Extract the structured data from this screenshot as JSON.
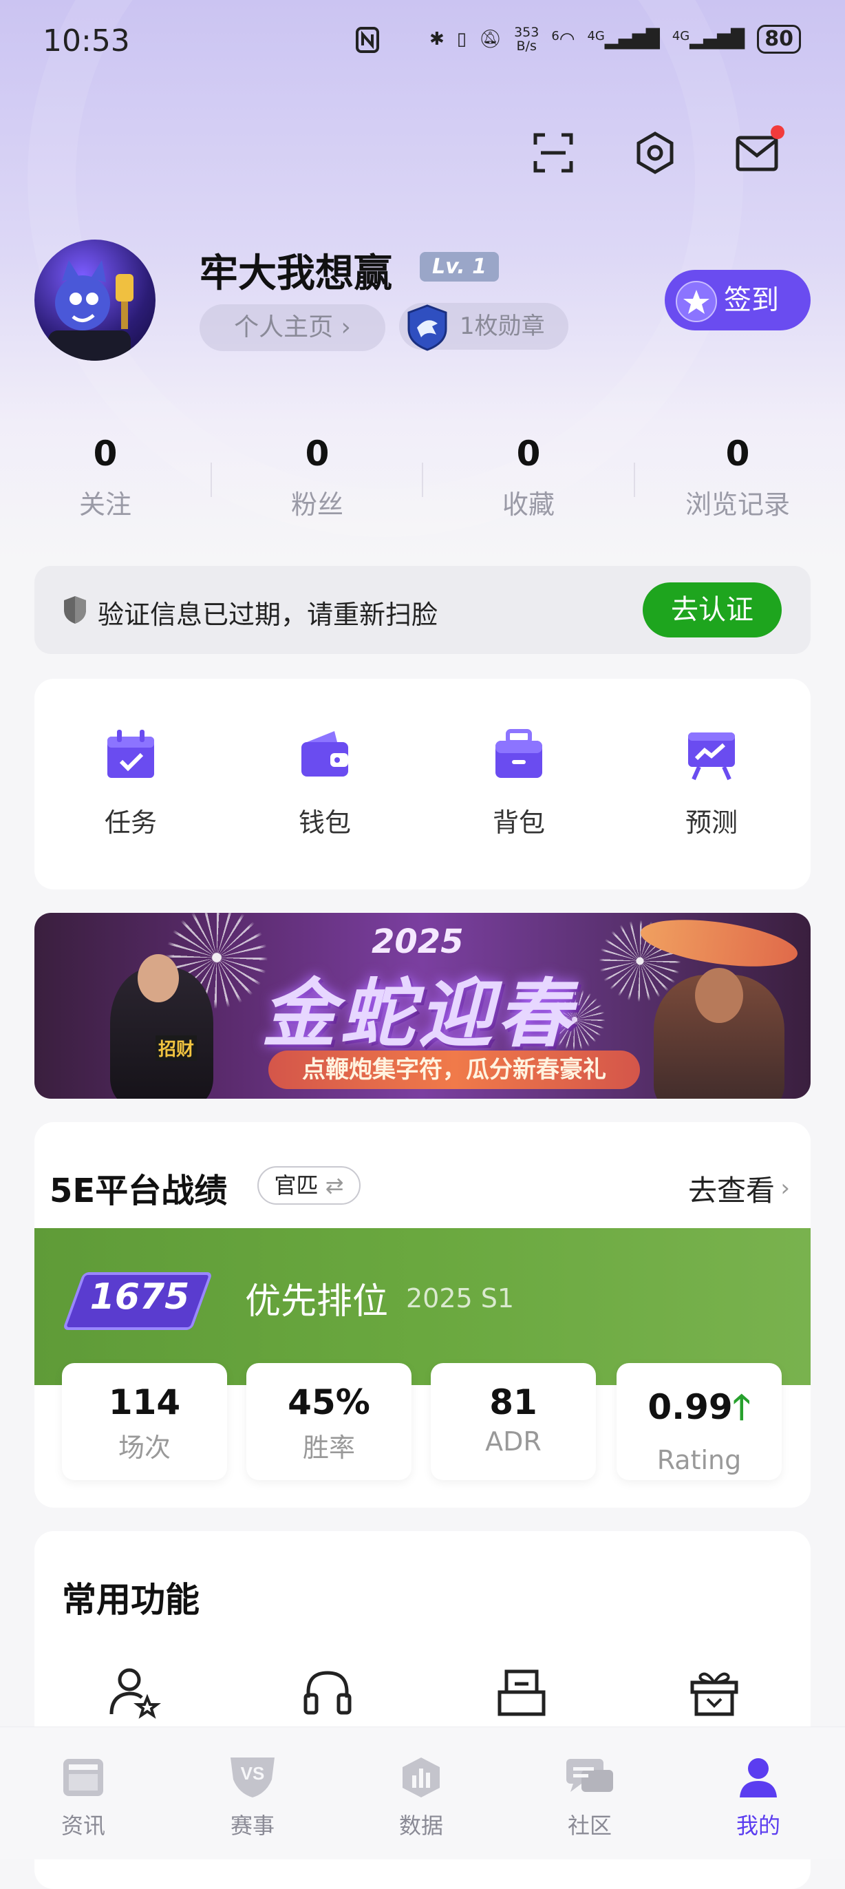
{
  "status_bar": {
    "time": "10:53",
    "net_speed_top": "353",
    "net_speed_bottom": "B/s",
    "sim1": "4G",
    "sim2": "4G",
    "wifi_label": "6",
    "battery": "80"
  },
  "profile": {
    "username": "牢大我想赢",
    "level": "Lv. 1",
    "homepage_label": "个人主页",
    "medal_label": "1枚勋章",
    "signin_label": "签到"
  },
  "stats": [
    {
      "value": "0",
      "label": "关注"
    },
    {
      "value": "0",
      "label": "粉丝"
    },
    {
      "value": "0",
      "label": "收藏"
    },
    {
      "value": "0",
      "label": "浏览记录"
    }
  ],
  "verify": {
    "message": "验证信息已过期，请重新扫脸",
    "button": "去认证"
  },
  "functions": [
    {
      "label": "任务",
      "icon": "calendar-check-icon"
    },
    {
      "label": "钱包",
      "icon": "wallet-icon"
    },
    {
      "label": "背包",
      "icon": "bag-icon"
    },
    {
      "label": "预测",
      "icon": "easel-chart-icon"
    }
  ],
  "banner": {
    "year": "2025",
    "title": "金蛇迎春",
    "subtitle": "点鞭炮集字符，瓜分新春豪礼",
    "badge": "招财"
  },
  "record": {
    "title": "5E平台战绩",
    "tag": "官匹",
    "tag_icon": "swap-icon",
    "goto": "去查看",
    "elo": "1675",
    "mode": "优先排位",
    "season": "2025 S1",
    "items": [
      {
        "value": "114",
        "label": "场次"
      },
      {
        "value": "45%",
        "label": "胜率"
      },
      {
        "value": "81",
        "label": "ADR"
      },
      {
        "value": "0.99",
        "label": "Rating"
      }
    ]
  },
  "common": {
    "title": "常用功能"
  },
  "tabs": [
    {
      "label": "资讯"
    },
    {
      "label": "赛事"
    },
    {
      "label": "数据"
    },
    {
      "label": "社区"
    },
    {
      "label": "我的"
    }
  ],
  "colors": {
    "accent": "#6a4cf0",
    "verify_green": "#1ea51e",
    "record_green": "#6aa83f",
    "notify_red": "#f23b3b"
  }
}
